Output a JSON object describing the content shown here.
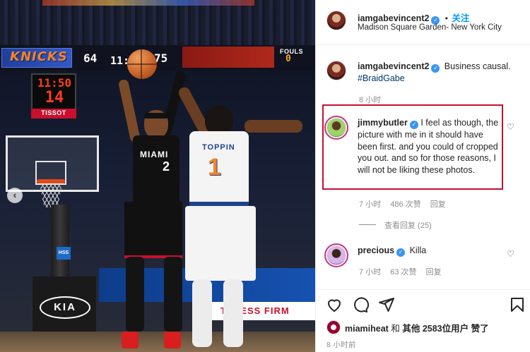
{
  "photo": {
    "scoreboard": {
      "team_left": "KNICKS",
      "home_score": "64",
      "clock": "11:50",
      "away_score": "75",
      "fouls_label": "FOULS",
      "fouls_value": "0"
    },
    "shot_clock": {
      "time": "11:50",
      "shot": "14",
      "sponsor": "TISSOT"
    },
    "jersey_heat": {
      "team": "MIAMI",
      "number": "2"
    },
    "jersey_knicks": {
      "name": "TOPPIN",
      "number": "1"
    },
    "sponsors": {
      "kia": "KIA",
      "hss": "HSS",
      "banner": "TTRESS FIRM"
    },
    "nav_prev_glyph": "‹"
  },
  "post": {
    "author": "iamgabevincent2",
    "follow_label": "关注",
    "location": "Madison Square Garden- New York City",
    "caption": {
      "text": "Business causal.",
      "hashtag": "#BraidGabe",
      "time": "8 小时"
    },
    "comments": [
      {
        "username": "jimmybutler",
        "text": "I feel as though, the picture with me in it should have been first. and you could of cropped you out. and so for those reasons, I will not be liking these photos.",
        "time": "7 小时",
        "likes": "486 次赞",
        "reply": "回复",
        "view_replies": "查看回复 (25)"
      },
      {
        "username": "precious",
        "text": "Killa",
        "time": "7 小时",
        "likes": "63 次赞",
        "reply": "回复"
      }
    ],
    "likes": {
      "user": "miamiheat",
      "and": "和",
      "others": "其他",
      "count": "2583",
      "suffix": "位用户 赞了"
    },
    "timestamp": "8 小时前"
  },
  "colors": {
    "link_blue": "#0095f6",
    "verified_blue": "#3897f0",
    "highlight_red": "#c8102e"
  },
  "icons": [
    "verified-icon",
    "heart-icon",
    "comment-icon",
    "share-icon",
    "save-icon",
    "chevron-left-icon"
  ]
}
